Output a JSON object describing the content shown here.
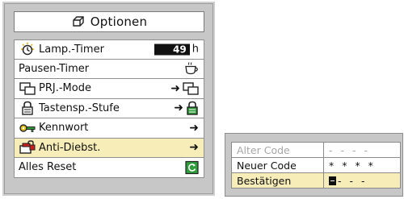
{
  "menu": {
    "title": "Optionen",
    "items": [
      {
        "label": "Lamp.-Timer",
        "icon": "lamp-timer-icon",
        "value": "49",
        "unit": "h"
      },
      {
        "label": "Pausen-Timer",
        "icon": "",
        "value_icon": "coffee-cup-icon"
      },
      {
        "label": "PRJ.-Mode",
        "icon": "projector-mode-icon",
        "value_icon": "projector-mode-icon"
      },
      {
        "label": "Tastensp.-Stufe",
        "icon": "padlock-icon",
        "value_icon": "padlock-green-icon"
      },
      {
        "label": "Kennwort",
        "icon": "key-icon"
      },
      {
        "label": "Anti-Diebst.",
        "icon": "anti-theft-icon",
        "selected": true
      },
      {
        "label": "Alles Reset",
        "icon": "",
        "value_icon": "reset-icon"
      }
    ]
  },
  "code_dialog": {
    "rows": [
      {
        "label": "Alter Code",
        "value": "- - - -",
        "state": "disabled"
      },
      {
        "label": "Neuer Code",
        "value": "* * * *",
        "state": "normal"
      },
      {
        "label": "Bestätigen",
        "value": "- - -",
        "state": "active"
      }
    ]
  },
  "colors": {
    "selected_row": "#f6edb8",
    "panel": "#c7c7c7",
    "accent_green": "#2e9d3a",
    "accent_red": "#c8201e"
  }
}
